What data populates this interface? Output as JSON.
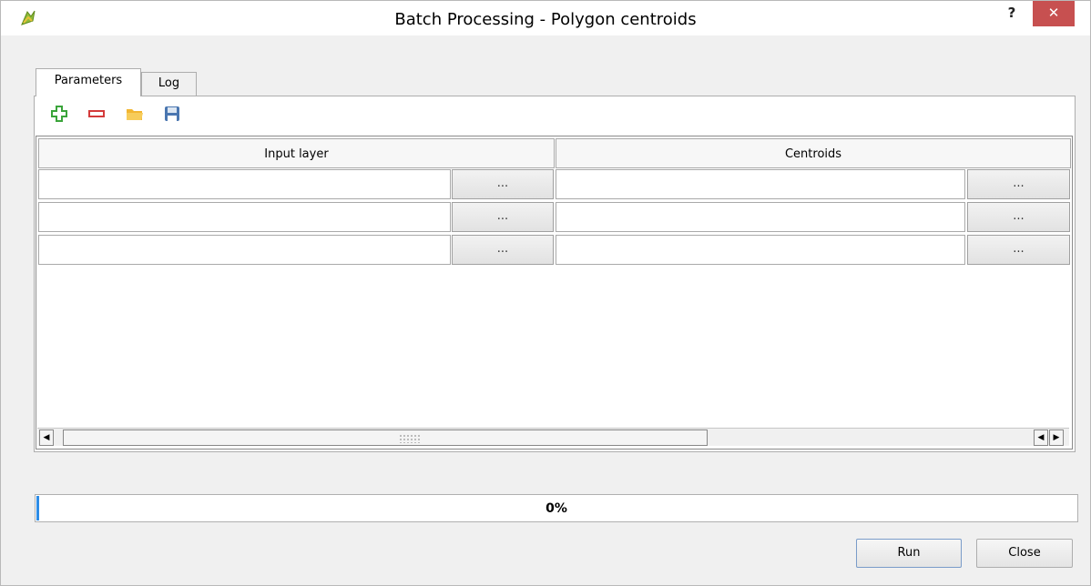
{
  "window": {
    "title": "Batch Processing - Polygon centroids",
    "help_label": "?",
    "close_label": "✕"
  },
  "tabs": [
    {
      "label": "Parameters",
      "active": true
    },
    {
      "label": "Log",
      "active": false
    }
  ],
  "toolbar": {
    "icons": [
      "add-row-icon",
      "remove-row-icon",
      "open-folder-icon",
      "save-icon"
    ]
  },
  "grid": {
    "columns": [
      "Input layer",
      "Centroids"
    ],
    "rows": [
      {
        "input_layer": "",
        "input_button": "...",
        "centroids": "",
        "centroids_button": "..."
      },
      {
        "input_layer": "",
        "input_button": "...",
        "centroids": "",
        "centroids_button": "..."
      },
      {
        "input_layer": "",
        "input_button": "...",
        "centroids": "",
        "centroids_button": "..."
      }
    ]
  },
  "progress": {
    "value": 0,
    "label": "0%"
  },
  "buttons": {
    "run": "Run",
    "close": "Close"
  },
  "colors": {
    "close_button": "#c75050",
    "progress_fill": "#2d8ce6",
    "add_icon": "#3aa43a",
    "remove_icon": "#d43a3a",
    "folder_icon": "#f2b632",
    "save_icon": "#4a76b0"
  }
}
